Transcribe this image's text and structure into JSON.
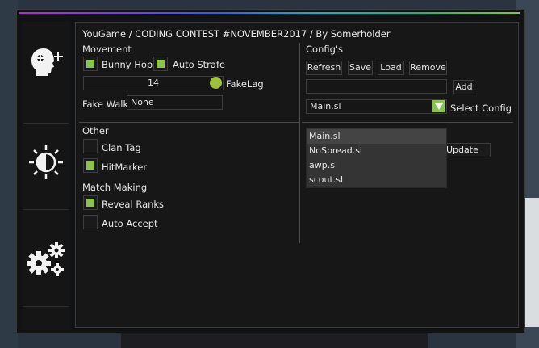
{
  "title": "YouGame / CODING CONTEST #NOVEMBER2017 / By Somerholder",
  "sidebar": {
    "tabs": [
      {
        "icon": "head-aim-icon"
      },
      {
        "icon": "brightness-icon"
      },
      {
        "icon": "gears-icon"
      }
    ]
  },
  "movement": {
    "heading": "Movement",
    "bunny_hop": {
      "label": "Bunny Hop",
      "checked": true
    },
    "auto_strafe": {
      "label": "Auto Strafe",
      "checked": true
    },
    "fakelag": {
      "label": "FakeLag",
      "value": "14"
    },
    "fake_walk": {
      "label": "Fake Walk",
      "value": "None"
    }
  },
  "other": {
    "heading": "Other",
    "clan_tag": {
      "label": "Clan Tag",
      "checked": false
    },
    "hitmarker": {
      "label": "HitMarker",
      "checked": true
    }
  },
  "match_making": {
    "heading": "Match Making",
    "reveal_ranks": {
      "label": "Reveal Ranks",
      "checked": true
    },
    "auto_accept": {
      "label": "Auto Accept",
      "checked": false
    }
  },
  "configs": {
    "heading": "Config's",
    "buttons": {
      "refresh": "Refresh",
      "save": "Save",
      "load": "Load",
      "remove": "Remove",
      "add": "Add",
      "update": "Update"
    },
    "name_input": "",
    "selected": "Main.sl",
    "select_label": "Select Config",
    "options": [
      "Main.sl",
      "NoSpread.sl",
      "awp.sl",
      "scout.sl"
    ]
  },
  "colors": {
    "accent": "#8bc34a"
  }
}
